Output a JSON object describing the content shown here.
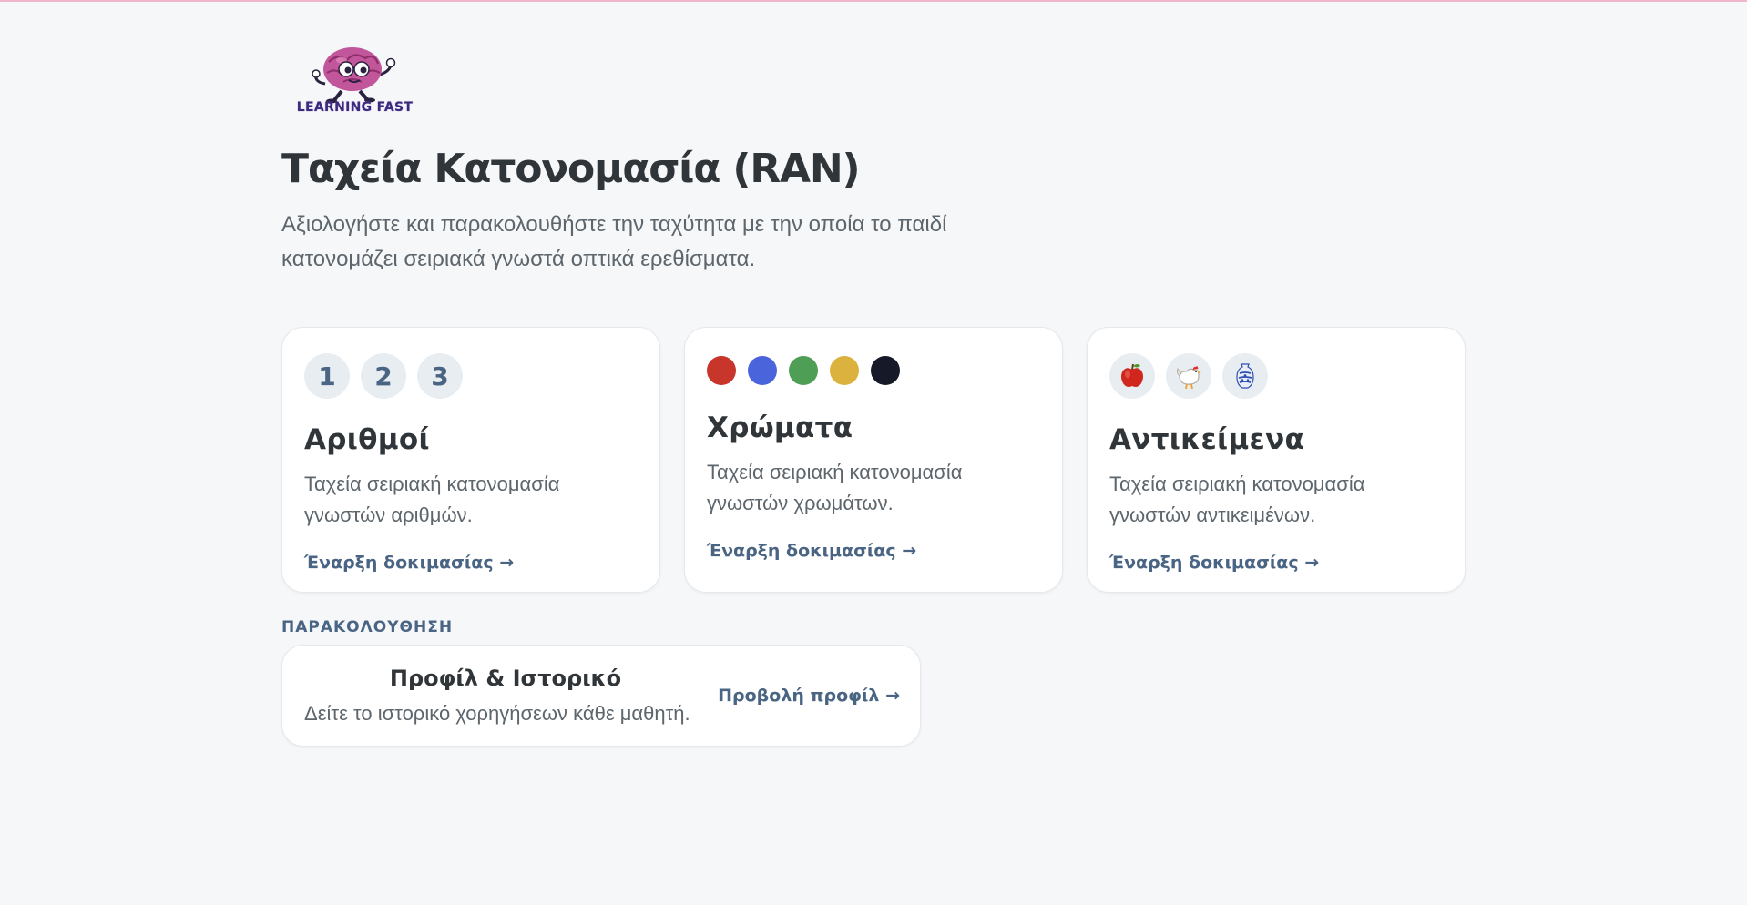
{
  "brand": {
    "logo_text": "LEARNING FAST"
  },
  "header": {
    "title": "Ταχεία Κατονομασία (RAN)",
    "subtitle": "Αξιολογήστε και παρακολουθήστε την ταχύτητα με την οποία το παιδί κατονομάζει σειριακά γνωστά οπτικά ερεθίσματα."
  },
  "cards": [
    {
      "title": "Αριθμοί",
      "description": "Ταχεία σειριακή κατονομασία γνωστών αριθμών.",
      "link": "Έναρξη δοκιμασίας →",
      "chips": [
        "1",
        "2",
        "3"
      ]
    },
    {
      "title": "Χρώματα",
      "description": "Ταχεία σειριακή κατονομασία γνωστών χρωμάτων.",
      "link": "Έναρξη δοκιμασίας →",
      "colors": [
        "#c8352b",
        "#4a65dc",
        "#4f9e55",
        "#dcb23e",
        "#161a28"
      ]
    },
    {
      "title": "Αντικείμενα",
      "description": "Ταχεία σειριακή κατονομασία γνωστών αντικειμένων.",
      "link": "Έναρξη δοκιμασίας →",
      "icons": [
        "apple-icon",
        "chicken-icon",
        "vase-icon"
      ]
    }
  ],
  "tracking": {
    "section_label": "ΠΑΡΑΚΟΛΟΥΘΗΣΗ",
    "title": "Προφίλ & Ιστορικό",
    "description": "Δείτε το ιστορικό χορηγήσεων κάθε μαθητή.",
    "link": "Προβολή προφίλ →"
  },
  "colors": {
    "accent": "#4a6583",
    "text": "#2f3539",
    "muted": "#5d666c",
    "chip_bg": "#e8edf2",
    "background": "#f6f7f9",
    "top_border": "#f0b6cc"
  }
}
